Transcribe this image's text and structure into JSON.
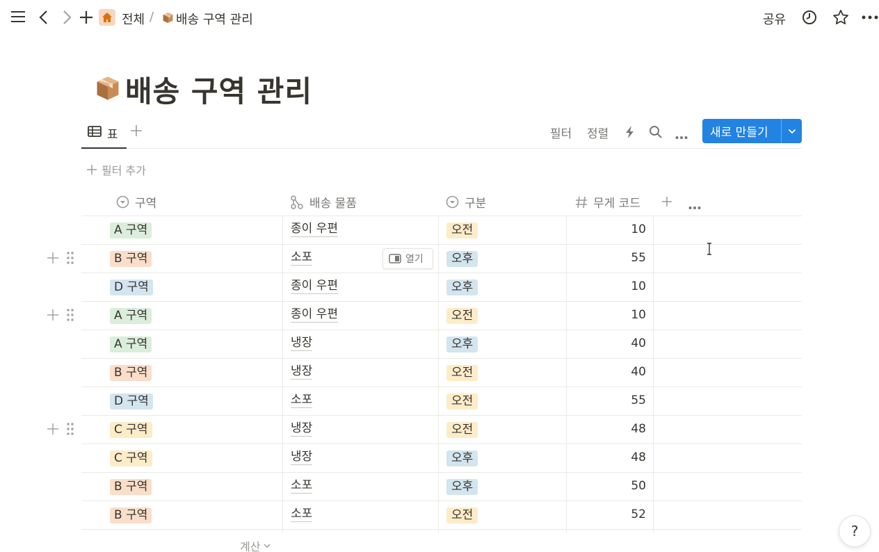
{
  "topbar": {
    "breadcrumb_root": "전체",
    "breadcrumb_sep": "/",
    "breadcrumb_page": "배송 구역 관리",
    "share_label": "공유",
    "icons": [
      "menu-icon",
      "back-icon",
      "forward-icon",
      "plus-icon",
      "home-icon",
      "clock-icon",
      "star-icon",
      "more-icon"
    ]
  },
  "page": {
    "title": "배송 구역 관리",
    "icon": "package-icon"
  },
  "view": {
    "tab_label": "표",
    "filter_label": "필터",
    "sort_label": "정렬",
    "new_button_label": "새로 만들기",
    "add_filter_label": "필터 추가"
  },
  "table": {
    "columns": [
      {
        "label": "구역",
        "icon": "select-icon"
      },
      {
        "label": "배송 물품",
        "icon": "relation-icon"
      },
      {
        "label": "구분",
        "icon": "select-icon"
      },
      {
        "label": "무게 코드",
        "icon": "number-icon"
      }
    ],
    "open_button_label": "열기",
    "rows": [
      {
        "zone": "A 구역",
        "item": "종이 우편",
        "shift": "오전",
        "weight": "10"
      },
      {
        "zone": "B 구역",
        "item": "소포",
        "shift": "오후",
        "weight": "55"
      },
      {
        "zone": "D 구역",
        "item": "종이 우편",
        "shift": "오후",
        "weight": "10"
      },
      {
        "zone": "A 구역",
        "item": "종이 우편",
        "shift": "오전",
        "weight": "10"
      },
      {
        "zone": "A 구역",
        "item": "냉장",
        "shift": "오후",
        "weight": "40"
      },
      {
        "zone": "B 구역",
        "item": "냉장",
        "shift": "오전",
        "weight": "40"
      },
      {
        "zone": "D 구역",
        "item": "소포",
        "shift": "오전",
        "weight": "55"
      },
      {
        "zone": "C 구역",
        "item": "냉장",
        "shift": "오전",
        "weight": "48"
      },
      {
        "zone": "C 구역",
        "item": "냉장",
        "shift": "오후",
        "weight": "48"
      },
      {
        "zone": "B 구역",
        "item": "소포",
        "shift": "오후",
        "weight": "50"
      },
      {
        "zone": "B 구역",
        "item": "소포",
        "shift": "오전",
        "weight": "52"
      }
    ],
    "calc_label": "계산"
  },
  "colors": {
    "accent": "#2383e2",
    "zone_A": "#dbeddb",
    "zone_B": "#fadec9",
    "zone_C": "#fdecc8",
    "zone_D": "#d3e5ef",
    "shift_am": "#fdecc8",
    "shift_pm": "#d3e5ef"
  },
  "help_label": "?"
}
